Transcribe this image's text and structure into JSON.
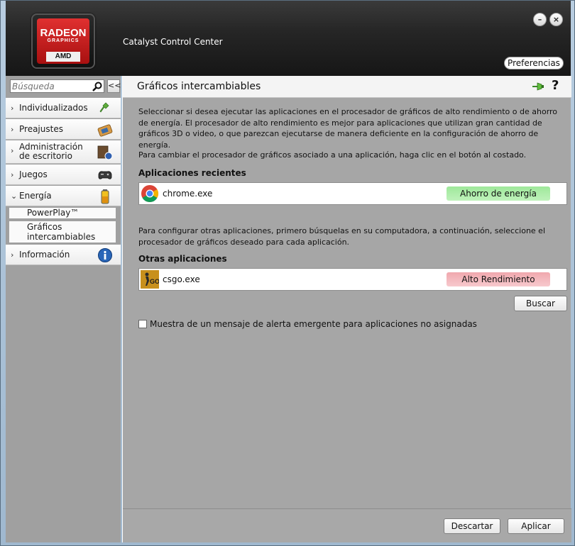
{
  "window": {
    "title": "Catalyst Control Center"
  },
  "logo": {
    "brand": "RADEON",
    "subtitle": "GRAPHICS",
    "maker": "AMD"
  },
  "header": {
    "minimize_label": "–",
    "close_label": "×",
    "preferences_label": "Preferencias"
  },
  "sidebar": {
    "search_placeholder": "Búsqueda",
    "collapse_label": "<<",
    "items": [
      {
        "label": "Individualizados",
        "icon": "pin-icon"
      },
      {
        "label": "Preajustes",
        "icon": "preset-icon"
      },
      {
        "label": "Administración de escritorio",
        "icon": "desktop-icon"
      },
      {
        "label": "Juegos",
        "icon": "gamepad-icon"
      },
      {
        "label": "Energía",
        "icon": "battery-icon",
        "expanded": true
      },
      {
        "label": "Información",
        "icon": "info-icon"
      }
    ],
    "sub_items": [
      {
        "label": "PowerPlay™"
      },
      {
        "label": "Gráficos intercambiables",
        "selected": true
      }
    ]
  },
  "main": {
    "title": "Gráficos intercambiables",
    "intro": "Seleccionar si desea ejecutar las aplicaciones en el procesador de gráficos de alto rendimiento o de ahorro de energía. El procesador de alto rendimiento es mejor para aplicaciones que utilizan gran cantidad de gráficos 3D o video, o que parezcan ejecutarse de manera deficiente en la configuración de ahorro de energía.",
    "change_hint": "Para cambiar el procesador de gráficos asociado a una aplicación, haga clic en el botón al costado.",
    "recent_title": "Aplicaciones recientes",
    "recent_apps": [
      {
        "name": "chrome.exe",
        "mode": "Ahorro de energía",
        "mode_color": "#9ee89a"
      }
    ],
    "other_hint": "Para configurar otras aplicaciones, primero búsquelas en su computadora, a continuación, seleccione el procesador de gráficos deseado para cada aplicación.",
    "other_title": "Otras aplicaciones",
    "other_apps": [
      {
        "name": "csgo.exe",
        "mode": "Alto Rendimiento",
        "mode_color": "#f0a8ae"
      }
    ],
    "browse_label": "Buscar",
    "alert_checkbox_label": "Muestra de un mensaje de alerta emergente para aplicaciones no asignadas",
    "alert_checked": false
  },
  "footer": {
    "discard_label": "Descartar",
    "apply_label": "Aplicar"
  }
}
